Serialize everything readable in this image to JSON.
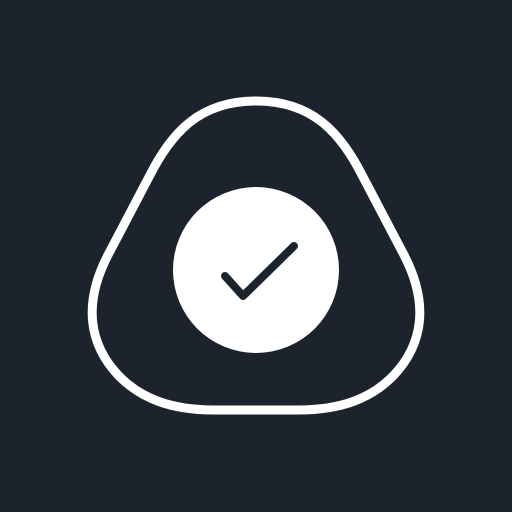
{
  "colors": {
    "background": "#1d232d",
    "foreground": "#ffffff"
  },
  "icon": {
    "name": "rounded-triangle-check-icon",
    "outline_shape": "rounded-triangle",
    "inner_badge": "check-circle-icon",
    "glyph": "checkmark-icon"
  }
}
